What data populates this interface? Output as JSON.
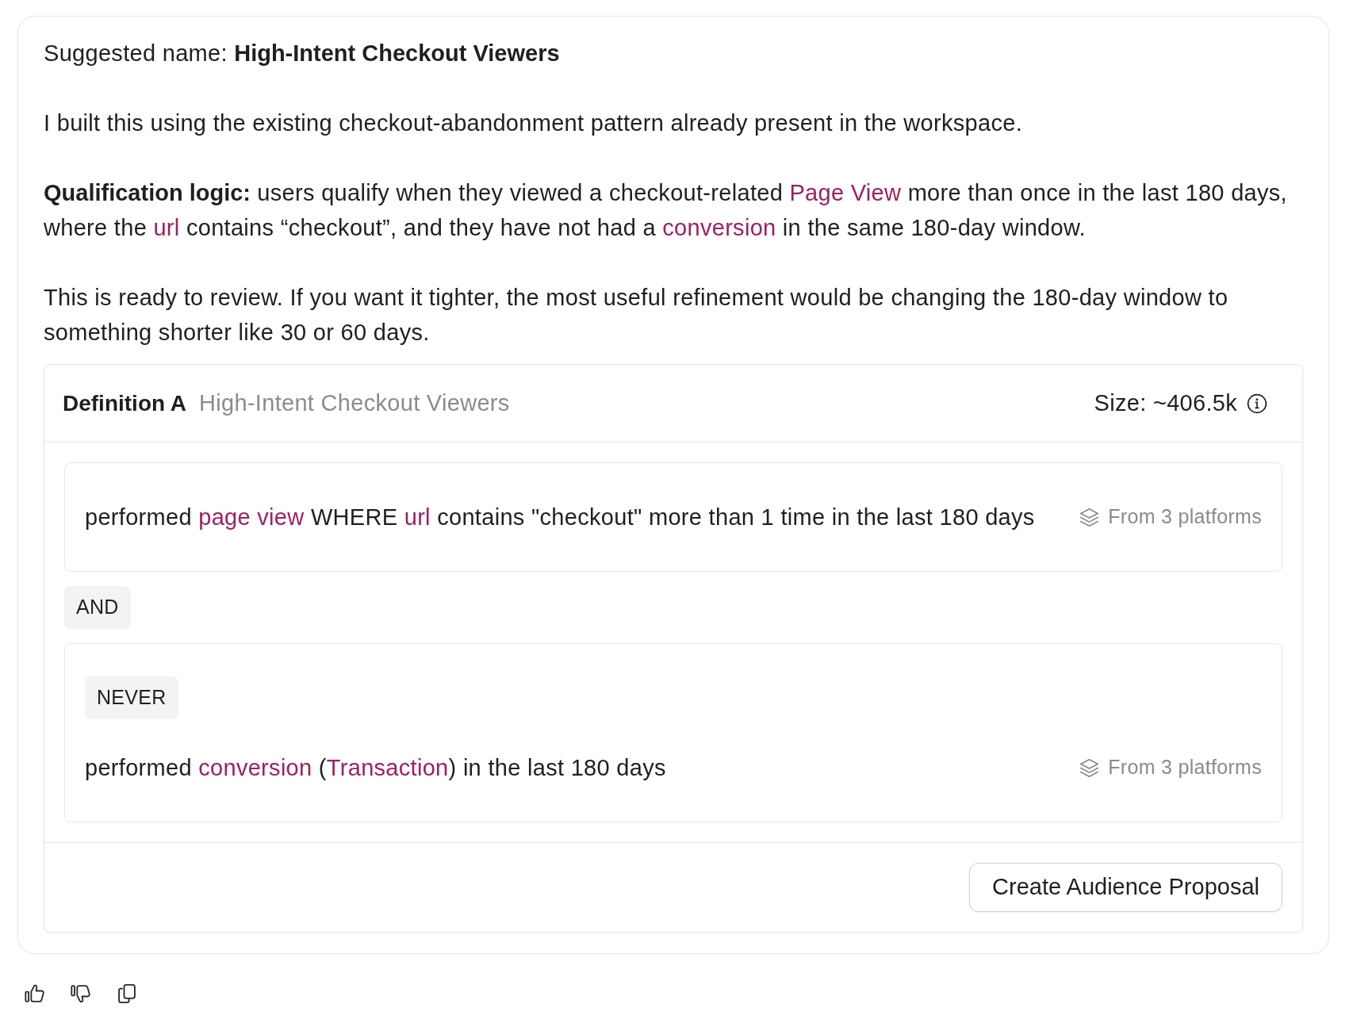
{
  "message": {
    "paragraphs": [
      {
        "segments": [
          {
            "kind": "plain",
            "text": "Suggested name: "
          },
          {
            "kind": "bold",
            "text": "High-Intent Checkout Viewers"
          }
        ]
      },
      {
        "segments": [
          {
            "kind": "plain",
            "text": "I built this using the existing checkout-abandonment pattern already present in the workspace."
          }
        ]
      },
      {
        "segments": [
          {
            "kind": "bold",
            "text": "Qualification logic:"
          },
          {
            "kind": "plain",
            "text": " users qualify when they viewed a checkout-related "
          },
          {
            "kind": "term",
            "text": "Page View"
          },
          {
            "kind": "plain",
            "text": " more than once in the last 180 days, where the "
          },
          {
            "kind": "term",
            "text": "url"
          },
          {
            "kind": "plain",
            "text": " contains “checkout”, and they have not had a "
          },
          {
            "kind": "term",
            "text": "conversion"
          },
          {
            "kind": "plain",
            "text": " in the same 180-day window."
          }
        ]
      },
      {
        "segments": [
          {
            "kind": "plain",
            "text": "This is ready to review. If you want it tighter, the most useful refinement would be changing the 180-day window to something shorter like 30 or 60 days."
          }
        ]
      }
    ]
  },
  "definition": {
    "label": "Definition A",
    "name": "High-Intent Checkout Viewers",
    "size": "Size: ~406.5k",
    "conditions": [
      {
        "kind": "rule",
        "segments": [
          {
            "kind": "plain",
            "text": "performed "
          },
          {
            "kind": "term",
            "text": "page view"
          },
          {
            "kind": "plain",
            "text": " WHERE "
          },
          {
            "kind": "term",
            "text": "url"
          },
          {
            "kind": "plain",
            "text": " contains \"checkout\" more than 1 time in the last 180 days"
          }
        ],
        "source": "From 3 platforms"
      },
      {
        "kind": "operator",
        "text": "AND"
      },
      {
        "kind": "rule",
        "qualifier": "NEVER",
        "segments": [
          {
            "kind": "plain",
            "text": "performed "
          },
          {
            "kind": "term",
            "text": "conversion"
          },
          {
            "kind": "plain",
            "text": " ("
          },
          {
            "kind": "term",
            "text": "Transaction"
          },
          {
            "kind": "plain",
            "text": ") in the last 180 days"
          }
        ],
        "source": "From 3 platforms"
      }
    ],
    "action": "Create Audience Proposal"
  }
}
